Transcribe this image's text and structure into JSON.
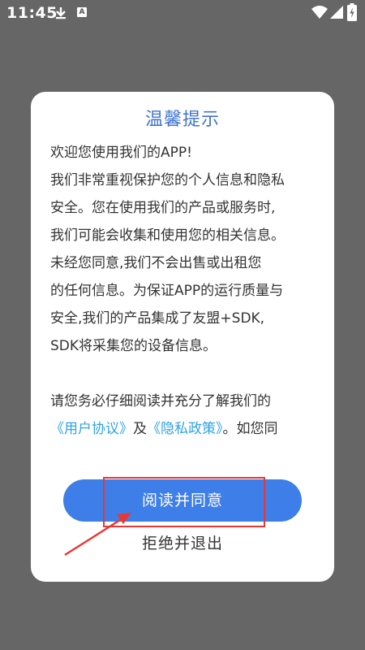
{
  "status_bar": {
    "time": "11:45",
    "icons": [
      "download-icon",
      "a-badge-icon",
      "wifi-icon",
      "signal-icon",
      "battery-icon"
    ],
    "badge_letter": "A"
  },
  "dialog": {
    "title": "温馨提示",
    "lines": [
      "欢迎您使用我们的APP!",
      "我们非常重视保护您的个人信息和隐私",
      "安全。您在使用我们的产品或服务时,",
      "我们可能会收集和使用您的相关信息。",
      "未经您同意,我们不会出售或出租您",
      "的任何信息。为保证APP的运行质量与",
      "安全,我们的产品集成了友盟+SDK,",
      "SDK将采集您的设备信息。"
    ],
    "read_prompt": "请您务必仔细阅读并充分了解我们的",
    "user_agreement_link": "《用户协议》",
    "and_text": "及",
    "privacy_policy_link": "《隐私政策》",
    "trailing_text": "。如您同",
    "agree_label": "阅读并同意",
    "reject_label": "拒绝并退出"
  },
  "colors": {
    "overlay": "#666666",
    "title": "#3f73d4",
    "link": "#2fa3e8",
    "button": "#3e7ee8",
    "annotation": "#e53935"
  }
}
